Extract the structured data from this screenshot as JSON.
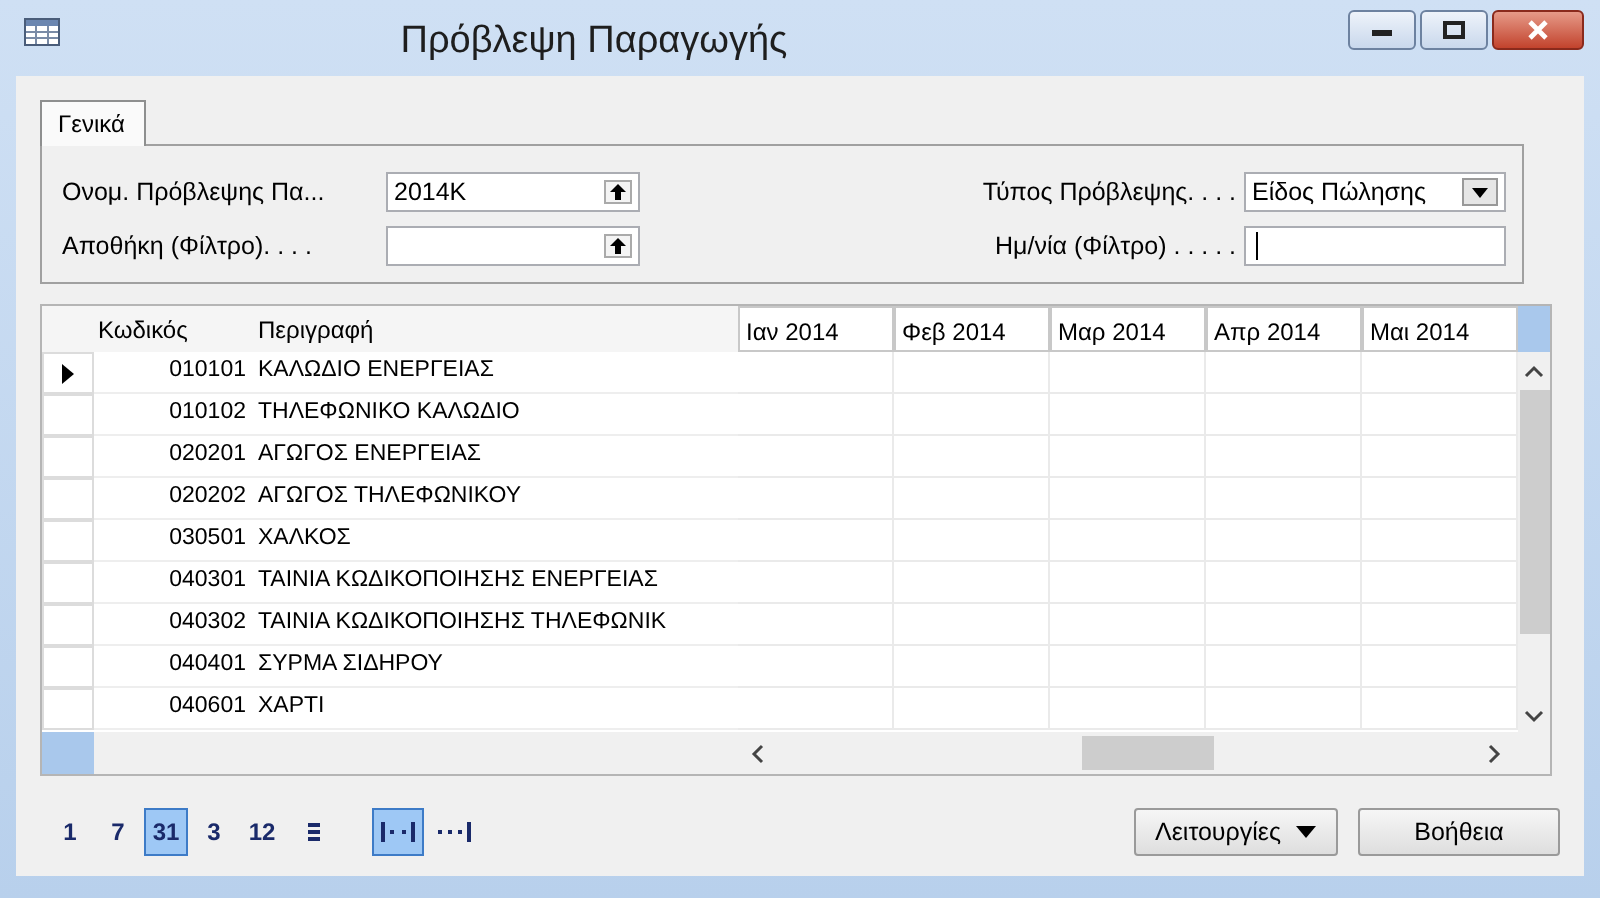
{
  "window": {
    "title": "Πρόβλεψη Παραγωγής"
  },
  "tabs": [
    {
      "label": "Γενικά",
      "selected": true
    }
  ],
  "form": {
    "left": [
      {
        "label": "Ονομ. Πρόβλεψης Πα...",
        "value": "2014K",
        "kind": "lookup",
        "focused": false
      },
      {
        "label": "Αποθήκη (Φίλτρο). . . .",
        "kind": "lookup",
        "focused": false
      }
    ],
    "right": [
      {
        "label": "Τύπος Πρόβλεψης. . . .",
        "value": "Είδος Πώλησης",
        "kind": "dropdown",
        "focused": false
      },
      {
        "label": "Ημ/νία (Φίλτρο) . . . . .",
        "kind": "text",
        "focused": true
      }
    ]
  },
  "grid": {
    "columns": [
      {
        "label": "Κωδικός"
      },
      {
        "label": "Περιγραφή"
      },
      {
        "label": "Ιαν 2014"
      },
      {
        "label": "Φεβ 2014"
      },
      {
        "label": "Μαρ 2014"
      },
      {
        "label": "Απρ 2014"
      },
      {
        "label": "Μαι 2014"
      }
    ],
    "rows": [
      {
        "code": "010101",
        "description": "ΚΑΛΩΔΙΟ ΕΝΕΡΓΕΙΑΣ",
        "selected": true
      },
      {
        "code": "010102",
        "description": "ΤΗΛΕΦΩΝΙΚΟ ΚΑΛΩΔΙΟ",
        "selected": false
      },
      {
        "code": "020201",
        "description": "ΑΓΩΓΟΣ ΕΝΕΡΓΕΙΑΣ",
        "selected": false
      },
      {
        "code": "020202",
        "description": "ΑΓΩΓΟΣ ΤΗΛΕΦΩΝΙΚΟΥ",
        "selected": false
      },
      {
        "code": "030501",
        "description": "ΧΑΛΚΟΣ",
        "selected": false
      },
      {
        "code": "040301",
        "description": "ΤΑΙΝΙΑ ΚΩΔΙΚΟΠΟΙΗΣΗΣ ΕΝΕΡΓΕΙΑΣ",
        "selected": false
      },
      {
        "code": "040302",
        "description": "ΤΑΙΝΙΑ ΚΩΔΙΚΟΠΟΙΗΣΗΣ ΤΗΛΕΦΩΝΙΚ",
        "selected": false
      },
      {
        "code": "040401",
        "description": "ΣΥΡΜΑ ΣΙΔΗΡΟΥ",
        "selected": false
      },
      {
        "code": "040601",
        "description": "ΧΑΡΤΙ",
        "selected": false
      }
    ]
  },
  "periods": [
    {
      "label": "1",
      "selected": false
    },
    {
      "label": "7",
      "selected": false
    },
    {
      "label": "31",
      "selected": true
    },
    {
      "label": "3",
      "selected": false
    },
    {
      "label": "12",
      "selected": false
    }
  ],
  "accounting_period": {
    "selected": false
  },
  "amount_types": [
    {
      "kind": "net-change",
      "selected": true
    },
    {
      "kind": "balance",
      "selected": false
    }
  ],
  "buttons": [
    {
      "label": "Λειτουργίες",
      "kind": "menu"
    },
    {
      "label": "Βοήθεια",
      "kind": "plain"
    }
  ]
}
